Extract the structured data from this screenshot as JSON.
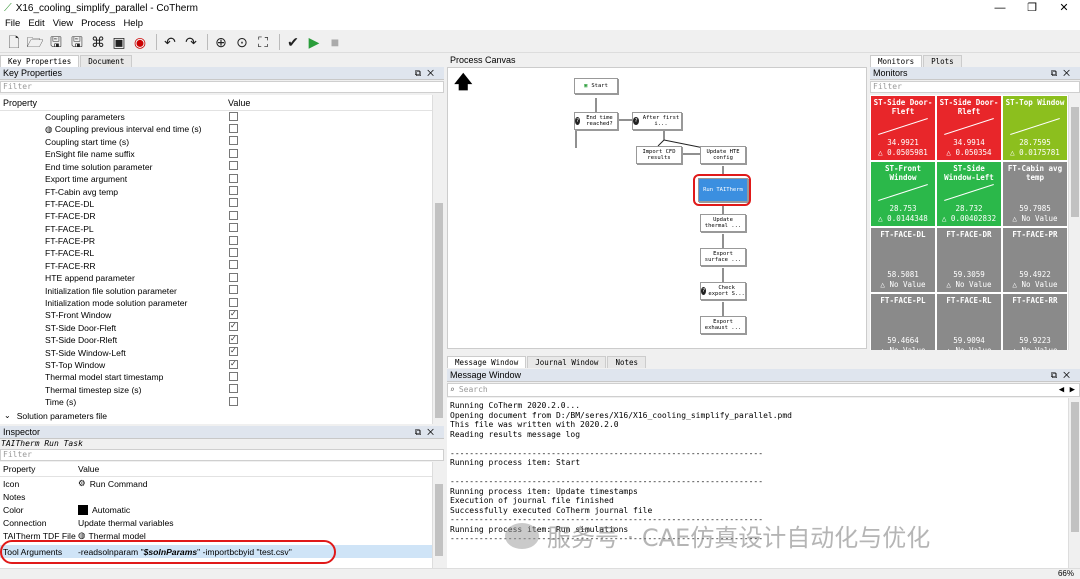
{
  "window": {
    "title": "X16_cooling_simplify_parallel - CoTherm",
    "min": "—",
    "max": "❐",
    "close": "✕"
  },
  "menu": [
    "File",
    "Edit",
    "View",
    "Process",
    "Help"
  ],
  "left_tabs": [
    "Key Properties",
    "Document"
  ],
  "key_properties": {
    "title": "Key Properties",
    "filter_placeholder": "Filter",
    "col_property": "Property",
    "col_value": "Value",
    "rows": [
      {
        "name": "Coupling parameters",
        "checked": false,
        "icon": ""
      },
      {
        "name": "Coupling previous interval end time (s)",
        "checked": false,
        "icon": "globe-icon"
      },
      {
        "name": "Coupling start time (s)",
        "checked": false,
        "icon": ""
      },
      {
        "name": "EnSight file name suffix",
        "checked": false,
        "icon": ""
      },
      {
        "name": "End time solution parameter",
        "checked": false,
        "icon": ""
      },
      {
        "name": "Export time argument",
        "checked": false,
        "icon": ""
      },
      {
        "name": "FT-Cabin avg temp",
        "checked": false,
        "icon": ""
      },
      {
        "name": "FT-FACE-DL",
        "checked": false,
        "icon": ""
      },
      {
        "name": "FT-FACE-DR",
        "checked": false,
        "icon": ""
      },
      {
        "name": "FT-FACE-PL",
        "checked": false,
        "icon": ""
      },
      {
        "name": "FT-FACE-PR",
        "checked": false,
        "icon": ""
      },
      {
        "name": "FT-FACE-RL",
        "checked": false,
        "icon": ""
      },
      {
        "name": "FT-FACE-RR",
        "checked": false,
        "icon": ""
      },
      {
        "name": "HTE append parameter",
        "checked": false,
        "icon": ""
      },
      {
        "name": "Initialization file solution parameter",
        "checked": false,
        "icon": ""
      },
      {
        "name": "Initialization mode solution parameter",
        "checked": false,
        "icon": ""
      },
      {
        "name": "ST-Front Window",
        "checked": true,
        "icon": ""
      },
      {
        "name": "ST-Side Door-Fleft",
        "checked": true,
        "icon": ""
      },
      {
        "name": "ST-Side Door-Rleft",
        "checked": true,
        "icon": ""
      },
      {
        "name": "ST-Side Window-Left",
        "checked": true,
        "icon": ""
      },
      {
        "name": "ST-Top Window",
        "checked": true,
        "icon": ""
      },
      {
        "name": "Thermal model start timestamp",
        "checked": false,
        "icon": ""
      },
      {
        "name": "Thermal timestep size (s)",
        "checked": false,
        "icon": ""
      },
      {
        "name": "Time (s)",
        "checked": false,
        "icon": ""
      }
    ],
    "group_label": "Solution parameters file"
  },
  "inspector": {
    "title": "Inspector",
    "task": "TAITherm Run Task",
    "filter_placeholder": "Filter",
    "col_property": "Property",
    "col_value": "Value",
    "rows": [
      {
        "name": "Icon",
        "value": "Run Command"
      },
      {
        "name": "Notes",
        "value": ""
      },
      {
        "name": "Color",
        "value": "Automatic"
      },
      {
        "name": "Connection",
        "value": "Update thermal variables"
      },
      {
        "name": "TAITherm TDF File",
        "value": "Thermal model"
      }
    ],
    "tool_args": {
      "name": "Tool Arguments",
      "pre": "-readsolnparam \"",
      "param": "$solnParams",
      "post": "\" -importbcbyid \"test.csv\""
    }
  },
  "canvas": {
    "title": "Process Canvas",
    "nodes": {
      "start": "Start",
      "end_time": "End time reached?",
      "after_first": "After first i...",
      "import_cfd": "Import CFD results",
      "update_hte": "Update HTE config",
      "run": "Run TAITherm",
      "update_thermal": "Update thermal ...",
      "export_surface": "Export surface ...",
      "check_export": "Check export S...",
      "export_exhaust": "Export exhaust ..."
    }
  },
  "right_tabs": [
    "Monitors",
    "Plots"
  ],
  "monitors": {
    "title": "Monitors",
    "filter_placeholder": "Filter",
    "tiles": [
      {
        "name": "ST-Side Door-Fleft",
        "value": "34.9921",
        "delta": "△ 0.0505981",
        "color": "#e8262a"
      },
      {
        "name": "ST-Side Door-Rleft",
        "value": "34.9914",
        "delta": "△ 0.050354",
        "color": "#e8262a"
      },
      {
        "name": "ST-Top Window",
        "value": "28.7595",
        "delta": "△ 0.0175781",
        "color": "#8cbf1e"
      },
      {
        "name": "ST-Front Window",
        "value": "28.753",
        "delta": "△ 0.0144348",
        "color": "#2bb84a"
      },
      {
        "name": "ST-Side Window-Left",
        "value": "28.732",
        "delta": "△ 0.00402832",
        "color": "#2bb84a"
      },
      {
        "name": "FT-Cabin avg temp",
        "value": "59.7985",
        "delta": "△ No Value",
        "color": "#8a8a8a"
      },
      {
        "name": "FT-FACE-DL",
        "value": "58.5081",
        "delta": "△ No Value",
        "color": "#8a8a8a"
      },
      {
        "name": "FT-FACE-DR",
        "value": "59.3059",
        "delta": "△ No Value",
        "color": "#8a8a8a"
      },
      {
        "name": "FT-FACE-PR",
        "value": "59.4922",
        "delta": "△ No Value",
        "color": "#8a8a8a"
      },
      {
        "name": "FT-FACE-PL",
        "value": "59.4664",
        "delta": "△ No Value",
        "color": "#8a8a8a"
      },
      {
        "name": "FT-FACE-RL",
        "value": "59.9094",
        "delta": "△ No Value",
        "color": "#8a8a8a"
      },
      {
        "name": "FT-FACE-RR",
        "value": "59.9223",
        "delta": "△ No Value",
        "color": "#8a8a8a"
      }
    ]
  },
  "bottom_tabs": [
    "Message Window",
    "Journal Window",
    "Notes"
  ],
  "message": {
    "title": "Message Window",
    "search_placeholder": "Search",
    "lines": [
      "Running CoTherm 2020.2.0...",
      "Opening document from D:/BM/seres/X16/X16_cooling_simplify_parallel.pmd",
      "This file was written with 2020.2.0",
      "Reading results message log",
      "",
      "-----------------------------------------------------------------",
      "Running process item: Start",
      "",
      "-----------------------------------------------------------------",
      "Running process item: Update timestamps",
      "Execution of journal file finished",
      "Successfully executed CoTherm journal file",
      "-----------------------------------------------------------------",
      "Running process item: Run simulations",
      "-----------------------------------------------------------------"
    ]
  },
  "watermark": "服务号 · CAE仿真设计自动化与优化",
  "status": {
    "zoom": "66%"
  }
}
